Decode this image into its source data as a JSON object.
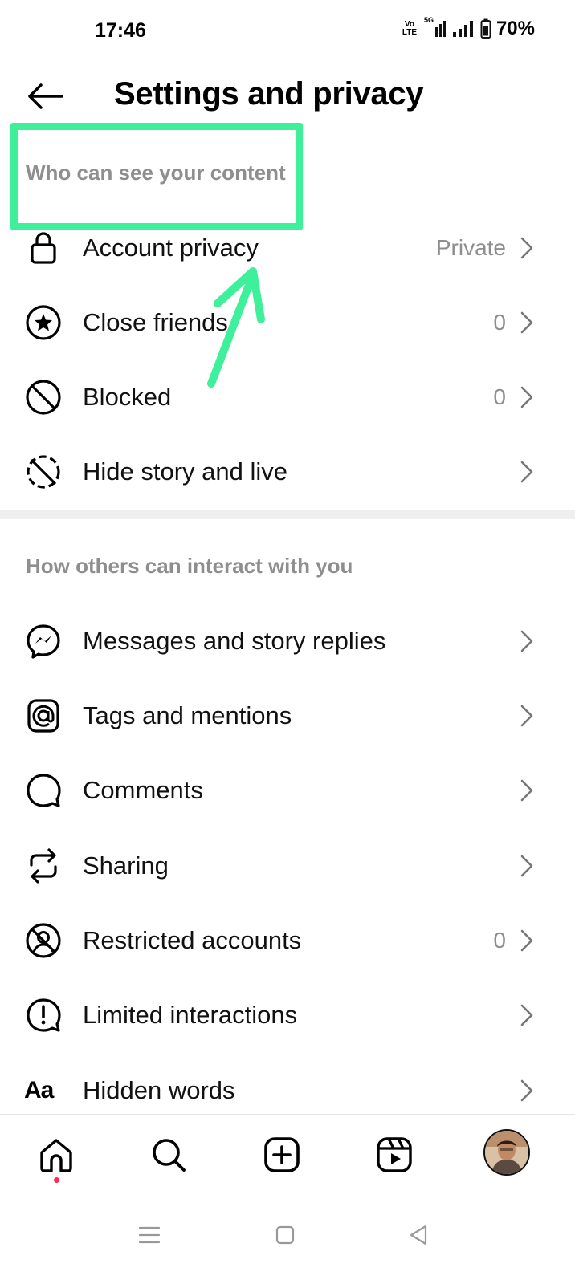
{
  "status_bar": {
    "time": "17:46",
    "network_label_top": "Vo",
    "network_label_bottom": "LTE",
    "network_5g": "5G",
    "battery": "70%"
  },
  "header": {
    "back_icon": "arrow-left-icon",
    "title": "Settings and privacy"
  },
  "sections": [
    {
      "title": "Who can see your content",
      "items": [
        {
          "label": "Account privacy",
          "value": "Private",
          "icon": "lock-icon"
        },
        {
          "label": "Close friends",
          "value": "0",
          "icon": "star-circle-icon"
        },
        {
          "label": "Blocked",
          "value": "0",
          "icon": "block-icon"
        },
        {
          "label": "Hide story and live",
          "value": "",
          "icon": "hide-story-icon"
        }
      ]
    },
    {
      "title": "How others can interact with you",
      "items": [
        {
          "label": "Messages and story replies",
          "value": "",
          "icon": "messenger-icon"
        },
        {
          "label": "Tags and mentions",
          "value": "",
          "icon": "at-sign-icon"
        },
        {
          "label": "Comments",
          "value": "",
          "icon": "comment-icon"
        },
        {
          "label": "Sharing",
          "value": "",
          "icon": "share-icon"
        },
        {
          "label": "Restricted accounts",
          "value": "0",
          "icon": "restricted-icon"
        },
        {
          "label": "Limited interactions",
          "value": "",
          "icon": "limited-icon"
        },
        {
          "label": "Hidden words",
          "value": "",
          "icon": "text-aa-icon"
        }
      ]
    }
  ],
  "hidden_words_icon_text": "Aa",
  "bottom_nav": [
    "home-icon",
    "search-icon",
    "create-icon",
    "reels-icon",
    "profile-avatar"
  ],
  "annotation": {
    "color": "#3ef09a"
  },
  "colors": {
    "secondary_text": "#8e8e8e",
    "notification_dot": "#ff2a4d"
  }
}
